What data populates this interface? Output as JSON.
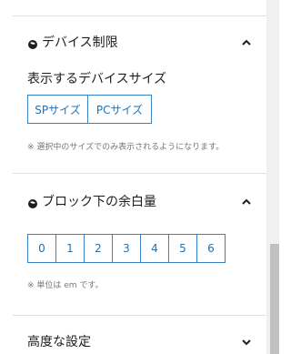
{
  "device_section": {
    "title": "デバイス制限",
    "field_label": "表示するデバイスサイズ",
    "buttons": [
      "SPサイズ",
      "PCサイズ"
    ],
    "note": "※ 選択中のサイズでのみ表示されるようになります。",
    "icon": "pill-icon",
    "toggle_icon": "chevron-up-icon"
  },
  "margin_section": {
    "title": "ブロック下の余白量",
    "buttons": [
      "0",
      "1",
      "2",
      "3",
      "4",
      "5",
      "6"
    ],
    "note": "※ 単位は em です。",
    "icon": "pill-icon",
    "toggle_icon": "chevron-up-icon"
  },
  "advanced_section": {
    "title": "高度な設定",
    "toggle_icon": "chevron-down-icon"
  },
  "colors": {
    "accent": "#2271b1",
    "text": "#1e1e1e",
    "muted": "#757575",
    "divider": "#e0e0e0"
  }
}
